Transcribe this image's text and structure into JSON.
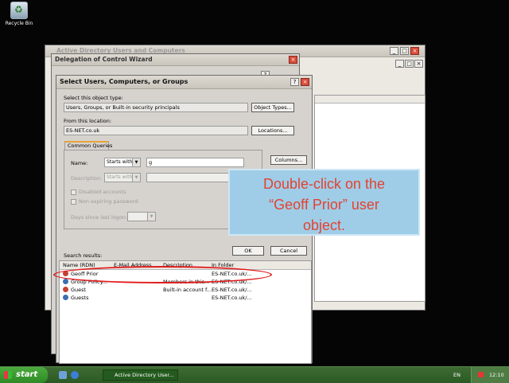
{
  "desktop": {
    "recycle_bin_label": "Recycle Bin"
  },
  "aduc_window": {
    "title": "Active Directory Users and Computers"
  },
  "delegation_wizard": {
    "title": "Delegation of Control Wizard"
  },
  "select_dialog": {
    "title": "Select Users, Computers, or Groups",
    "object_type_label": "Select this object type:",
    "object_type_value": "Users, Groups, or Built-in security principals",
    "object_types_button": "Object Types...",
    "location_label": "From this location:",
    "location_value": "ES-NET.co.uk",
    "locations_button": "Locations...",
    "tab_label": "Common Queries",
    "name_label": "Name:",
    "name_operator": "Starts with",
    "name_value": "g",
    "description_label": "Description:",
    "description_operator": "Starts with",
    "disabled_accounts_label": "Disabled accounts",
    "non_expiring_label": "Non expiring password",
    "days_label": "Days since last logon:",
    "columns_button": "Columns...",
    "ok_button": "OK",
    "cancel_button": "Cancel",
    "search_results_label": "Search results:",
    "columns": [
      "Name (RDN)",
      "E-Mail Address",
      "Description",
      "In Folder"
    ],
    "rows": [
      {
        "name": "Geoff Prior",
        "email": "",
        "description": "",
        "folder": "ES-NET.co.uk/...",
        "icon": "user-icon"
      },
      {
        "name": "Group Policy...",
        "email": "",
        "description": "Members in this...",
        "folder": "ES-NET.co.uk/...",
        "icon": "group-icon"
      },
      {
        "name": "Guest",
        "email": "",
        "description": "Built-in account f...",
        "folder": "ES-NET.co.uk/...",
        "icon": "user-icon"
      },
      {
        "name": "Guests",
        "email": "",
        "description": "",
        "folder": "ES-NET.co.uk/...",
        "icon": "group-icon"
      }
    ]
  },
  "callout": {
    "line1": "Double-click on the",
    "line2": "“Geoff Prior” user",
    "line3": "object."
  },
  "taskbar": {
    "start_label": "start",
    "task_label": "Active Directory User...",
    "language": "EN",
    "clock": "12:10"
  }
}
